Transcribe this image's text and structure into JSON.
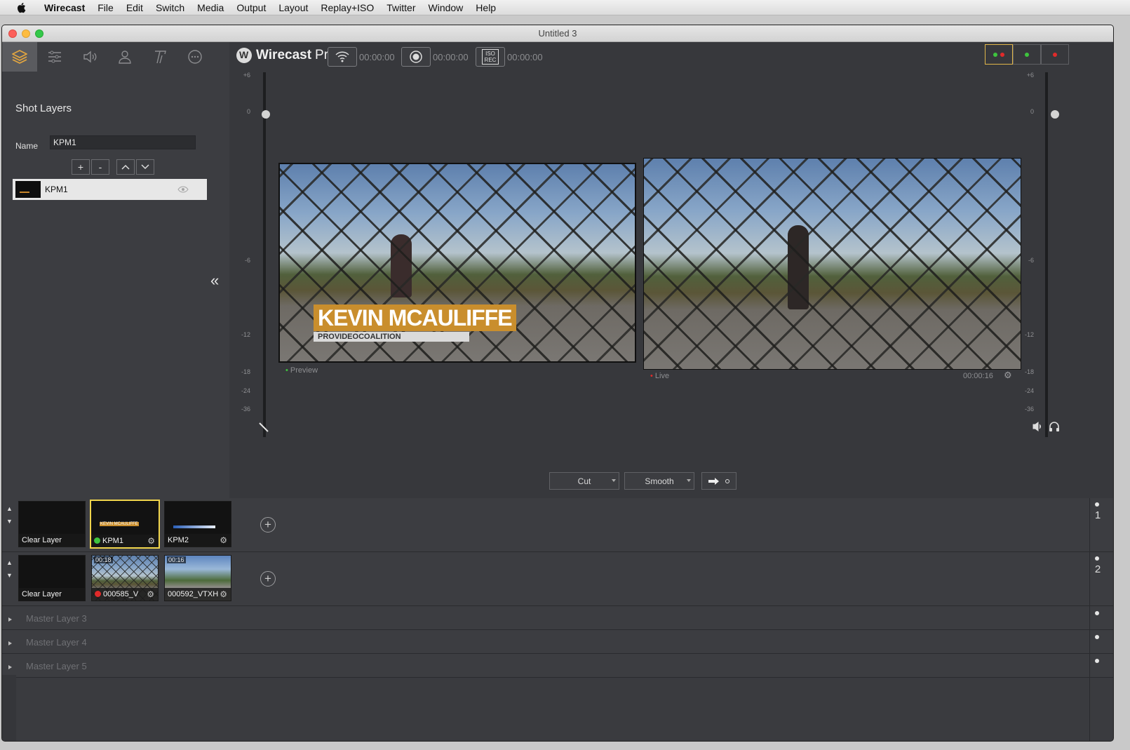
{
  "menubar": {
    "app_name": "Wirecast",
    "items": [
      "File",
      "Edit",
      "Switch",
      "Media",
      "Output",
      "Layout",
      "Replay+ISO",
      "Twitter",
      "Window",
      "Help"
    ]
  },
  "window": {
    "title": "Untitled 3"
  },
  "sidebar": {
    "tabs": [
      "layers-icon",
      "settings-sliders-icon",
      "audio-icon",
      "person-icon",
      "text-icon",
      "more-icon"
    ],
    "title": "Shot Layers",
    "name_label": "Name",
    "name_value": "KPM1",
    "buttons": [
      "+",
      "-",
      "^",
      "v"
    ],
    "layer_item": "KPM1",
    "collapse": "«"
  },
  "toolbar": {
    "brand_bold": "Wirecast",
    "brand_light": "Pro",
    "stream_time": "00:00:00",
    "record_time": "00:00:00",
    "iso_label": "ISO REC",
    "iso_time": "00:00:00",
    "status_colors": [
      "#3ec43e",
      "#e02a2a"
    ]
  },
  "meters": {
    "left_scale": [
      "+6",
      "0",
      "-6",
      "-12",
      "-18",
      "-24",
      "-36"
    ],
    "right_scale": [
      "+6",
      "0",
      "-6",
      "-12",
      "-18",
      "-24",
      "-36"
    ]
  },
  "preview": {
    "lower_third_title": "KEVIN MCAULIFFE",
    "lower_third_sub": "PROVIDEOCOALITION",
    "label": "Preview"
  },
  "live": {
    "label": "Live",
    "time": "00:00:16"
  },
  "transitions": {
    "cut": "Cut",
    "smooth": "Smooth"
  },
  "layers": {
    "row1": {
      "number": "1",
      "shots": [
        {
          "name": "Clear Layer"
        },
        {
          "name": "KPM1",
          "thumb_text": "KEVIN MCAULIFFE"
        },
        {
          "name": "KPM2"
        }
      ]
    },
    "row2": {
      "number": "2",
      "shots": [
        {
          "name": "Clear Layer"
        },
        {
          "name": "000585_V",
          "time": "00:18"
        },
        {
          "name": "000592_VTXH",
          "time": "00:16"
        }
      ]
    },
    "masters": [
      "Master Layer 3",
      "Master Layer 4",
      "Master Layer 5"
    ]
  }
}
